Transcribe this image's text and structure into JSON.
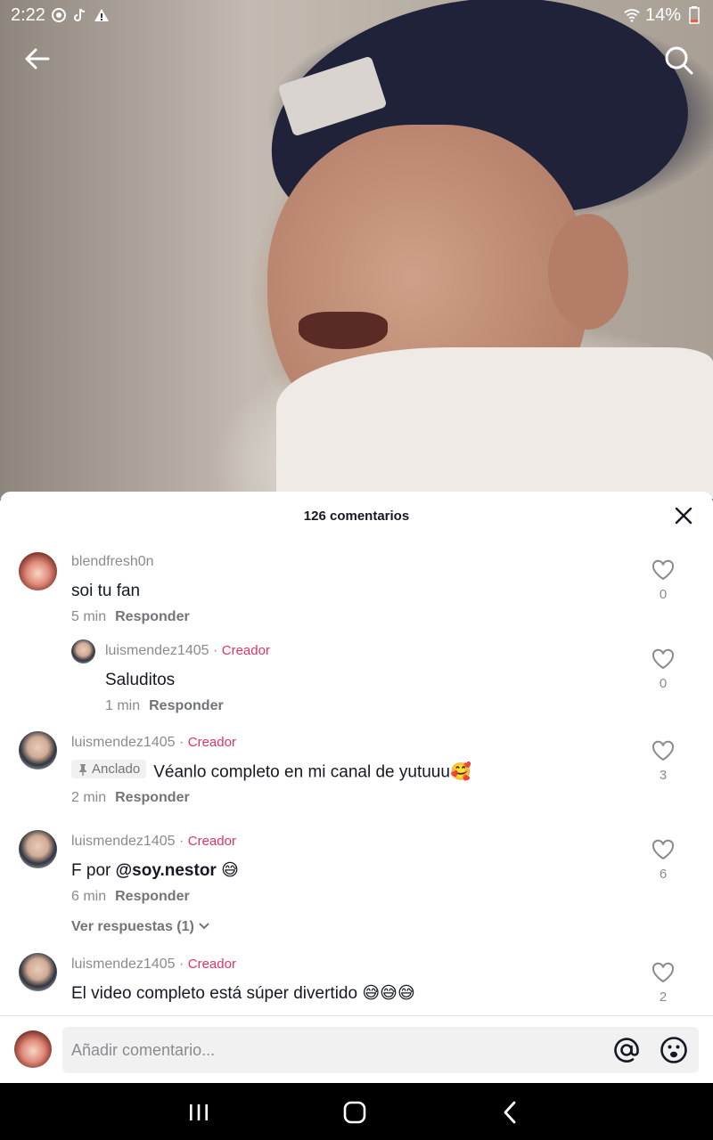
{
  "status_bar": {
    "time": "2:22",
    "battery": "14%",
    "icons": [
      "target-icon",
      "tiktok-icon",
      "warning-icon",
      "wifi-icon",
      "battery-icon"
    ]
  },
  "video": {
    "back_icon": "arrow-left-icon",
    "search_icon": "search-icon"
  },
  "sheet": {
    "title": "126 comentarios",
    "close_icon": "close-icon"
  },
  "comments": [
    {
      "username": "blendfresh0n",
      "text": "soi tu fan",
      "time": "5 min",
      "reply_label": "Responder",
      "likes": "0"
    },
    {
      "username": "luismendez1405",
      "badge": "Creador",
      "text": "Saluditos",
      "time": "1 min",
      "reply_label": "Responder",
      "likes": "0"
    },
    {
      "username": "luismendez1405",
      "badge": "Creador",
      "pinned_label": "Anclado",
      "text": "Véanlo completo en mi canal de yutuuu",
      "emoji": "🥰",
      "time": "2 min",
      "reply_label": "Responder",
      "likes": "3"
    },
    {
      "username": "luismendez1405",
      "badge": "Creador",
      "text_prefix": "F por ",
      "mention": "@soy.nestor",
      "emoji": "😅",
      "time": "6 min",
      "reply_label": "Responder",
      "likes": "6",
      "view_replies": "Ver respuestas (1)"
    },
    {
      "username": "luismendez1405",
      "badge": "Creador",
      "text": "El video completo está súper divertido",
      "emoji": "😅😅😅",
      "likes": "2"
    }
  ],
  "input_bar": {
    "placeholder": "Añadir comentario...",
    "at_icon": "at-icon",
    "emoji_icon": "smiley-icon"
  },
  "nav_bar": {
    "icons": [
      "recents-icon",
      "home-icon",
      "back-icon"
    ]
  }
}
